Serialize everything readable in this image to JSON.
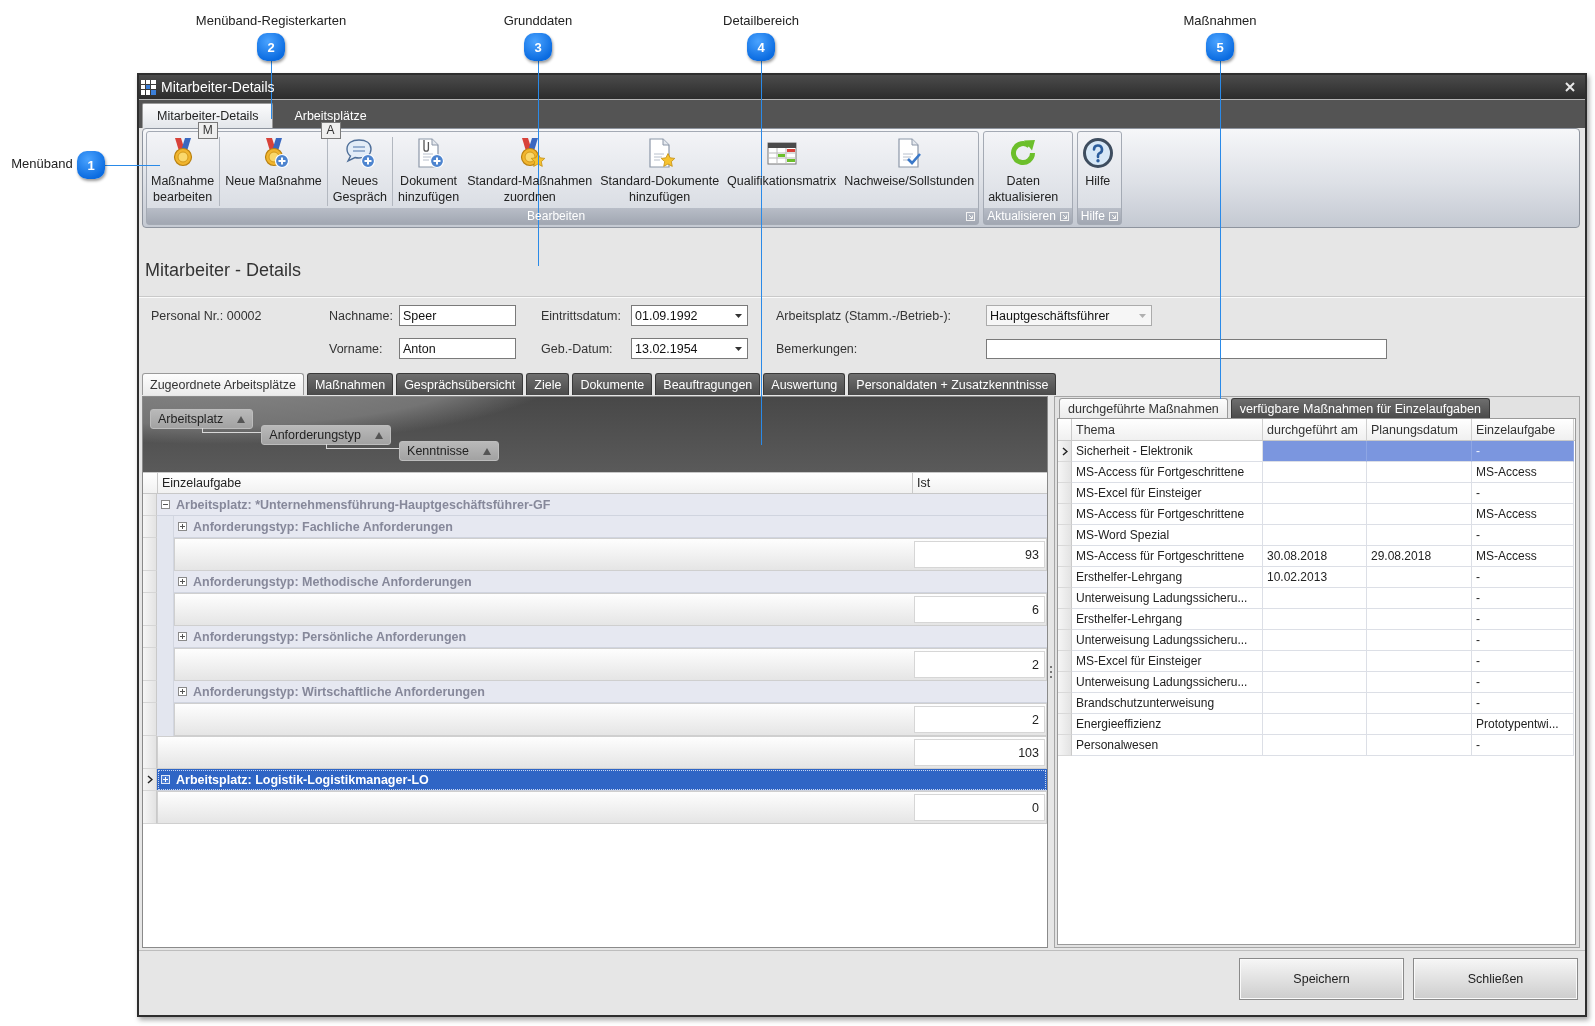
{
  "annotations": [
    {
      "number": "1",
      "label": "Menüband"
    },
    {
      "number": "2",
      "label": "Menüband-Registerkarten"
    },
    {
      "number": "3",
      "label": "Grunddaten"
    },
    {
      "number": "4",
      "label": "Detailbereich"
    },
    {
      "number": "5",
      "label": "Maßnahmen"
    }
  ],
  "window": {
    "title": "Mitarbeiter-Details"
  },
  "ribbon": {
    "tabs": [
      {
        "label": "Mitarbeiter-Details",
        "key_tip": "M",
        "selected": true
      },
      {
        "label": "Arbeitsplätze",
        "key_tip": "A",
        "selected": false
      }
    ],
    "groups": [
      {
        "label": "Bearbeiten",
        "sections": [
          [
            "Maßnahme\nbearbeiten"
          ],
          [
            "Neue Maßnahme"
          ],
          [
            "Neues\nGespräch"
          ],
          [
            "Dokument\nhinzufügen",
            "Standard-Maßnahmen\nzuordnen",
            "Standard-Dokumente\nhinzufügen",
            "Qualifikationsmatrix",
            "Nachweise/Sollstunden"
          ]
        ]
      },
      {
        "label": "Aktualisieren",
        "sections": [
          [
            "Daten\naktualisieren"
          ]
        ]
      },
      {
        "label": "Hilfe",
        "sections": [
          [
            "Hilfe"
          ]
        ]
      }
    ]
  },
  "details": {
    "heading": "Mitarbeiter - Details",
    "personal_nr": "Personal Nr.: 00002",
    "fields": [
      {
        "label": "Nachname:",
        "value": "Speer",
        "kind": "text"
      },
      {
        "label": "Eintrittsdatum:",
        "value": "01.09.1992",
        "kind": "date"
      },
      {
        "label": "Arbeitsplatz (Stamm.-/Betrieb-):",
        "value": "Hauptgeschäftsführer",
        "kind": "combo"
      },
      {
        "label": "Vorname:",
        "value": "Anton",
        "kind": "text"
      },
      {
        "label": "Geb.-Datum:",
        "value": "13.02.1954",
        "kind": "date"
      },
      {
        "label": "Bemerkungen:",
        "kind": "memo"
      }
    ]
  },
  "detail_tabs": [
    {
      "label": "Zugeordnete Arbeitsplätze",
      "selected": true
    },
    {
      "label": "Maßnahmen",
      "selected": false
    },
    {
      "label": "Gesprächsübersicht",
      "selected": false
    },
    {
      "label": "Ziele",
      "selected": false
    },
    {
      "label": "Dokumente",
      "selected": false
    },
    {
      "label": "Beauftragungen",
      "selected": false
    },
    {
      "label": "Auswertung",
      "selected": false
    },
    {
      "label": "Personaldaten + Zusatzkenntnisse",
      "selected": false
    }
  ],
  "assignments": {
    "group_by": [
      "Arbeitsplatz",
      "Anforderungstyp",
      "Kenntnisse"
    ],
    "columns": [
      "Einzelaufgabe",
      "Ist"
    ],
    "groups": [
      {
        "label": "Arbeitsplatz: *Unternehmensführung-Hauptgeschäftsführer-GF",
        "expanded": true,
        "selected": false,
        "total": "103",
        "children": [
          {
            "label": "Anforderungstyp: Fachliche Anforderungen",
            "expanded": false,
            "selected": false,
            "total": "93"
          },
          {
            "label": "Anforderungstyp: Methodische Anforderungen",
            "expanded": false,
            "selected": false,
            "total": "6"
          },
          {
            "label": "Anforderungstyp: Persönliche Anforderungen",
            "expanded": false,
            "selected": false,
            "total": "2"
          },
          {
            "label": "Anforderungstyp: Wirtschaftliche Anforderungen",
            "expanded": false,
            "selected": false,
            "total": "2"
          }
        ]
      },
      {
        "label": "Arbeitsplatz: Logistik-Logistikmanager-LO",
        "expanded": false,
        "selected": true,
        "total": "0"
      }
    ]
  },
  "measures": {
    "tabs": [
      {
        "label": "durchgeführte Maßnahmen",
        "selected": true
      },
      {
        "label": "verfügbare Maßnahmen für Einzelaufgaben",
        "selected": false
      }
    ],
    "columns": [
      "Thema",
      "durchgeführt am",
      "Planungsdatum",
      "Einzelaufgabe"
    ],
    "rows": [
      {
        "thema": "Sicherheit - Elektronik",
        "einzelaufgabe": "-",
        "selected": true
      },
      {
        "thema": "MS-Access für Fortgeschrittene",
        "einzelaufgabe": "MS-Access",
        "selected": false
      },
      {
        "thema": "MS-Excel für Einsteiger",
        "einzelaufgabe": "-",
        "selected": false
      },
      {
        "thema": "MS-Access für Fortgeschrittene",
        "einzelaufgabe": "MS-Access",
        "selected": false
      },
      {
        "thema": "MS-Word Spezial",
        "einzelaufgabe": "-",
        "selected": false
      },
      {
        "thema": "MS-Access für Fortgeschrittene",
        "durchgefuehrt_am": "30.08.2018",
        "planungsdatum": "29.08.2018",
        "einzelaufgabe": "MS-Access",
        "selected": false
      },
      {
        "thema": "Ersthelfer-Lehrgang",
        "durchgefuehrt_am": "10.02.2013",
        "einzelaufgabe": "-",
        "selected": false
      },
      {
        "thema": "Unterweisung Ladungssicheru...",
        "einzelaufgabe": "-",
        "selected": false
      },
      {
        "thema": "Ersthelfer-Lehrgang",
        "einzelaufgabe": "-",
        "selected": false
      },
      {
        "thema": "Unterweisung Ladungssicheru...",
        "einzelaufgabe": "-",
        "selected": false
      },
      {
        "thema": "MS-Excel für Einsteiger",
        "einzelaufgabe": "-",
        "selected": false
      },
      {
        "thema": "Unterweisung Ladungssicheru...",
        "einzelaufgabe": "-",
        "selected": false
      },
      {
        "thema": "Brandschutzunterweisung",
        "einzelaufgabe": "-",
        "selected": false
      },
      {
        "thema": "Energieeffizienz",
        "einzelaufgabe": "Prototypentwi...",
        "selected": false
      },
      {
        "thema": "Personalwesen",
        "einzelaufgabe": "-",
        "selected": false
      }
    ]
  },
  "buttons": [
    "Speichern",
    "Schließen"
  ]
}
